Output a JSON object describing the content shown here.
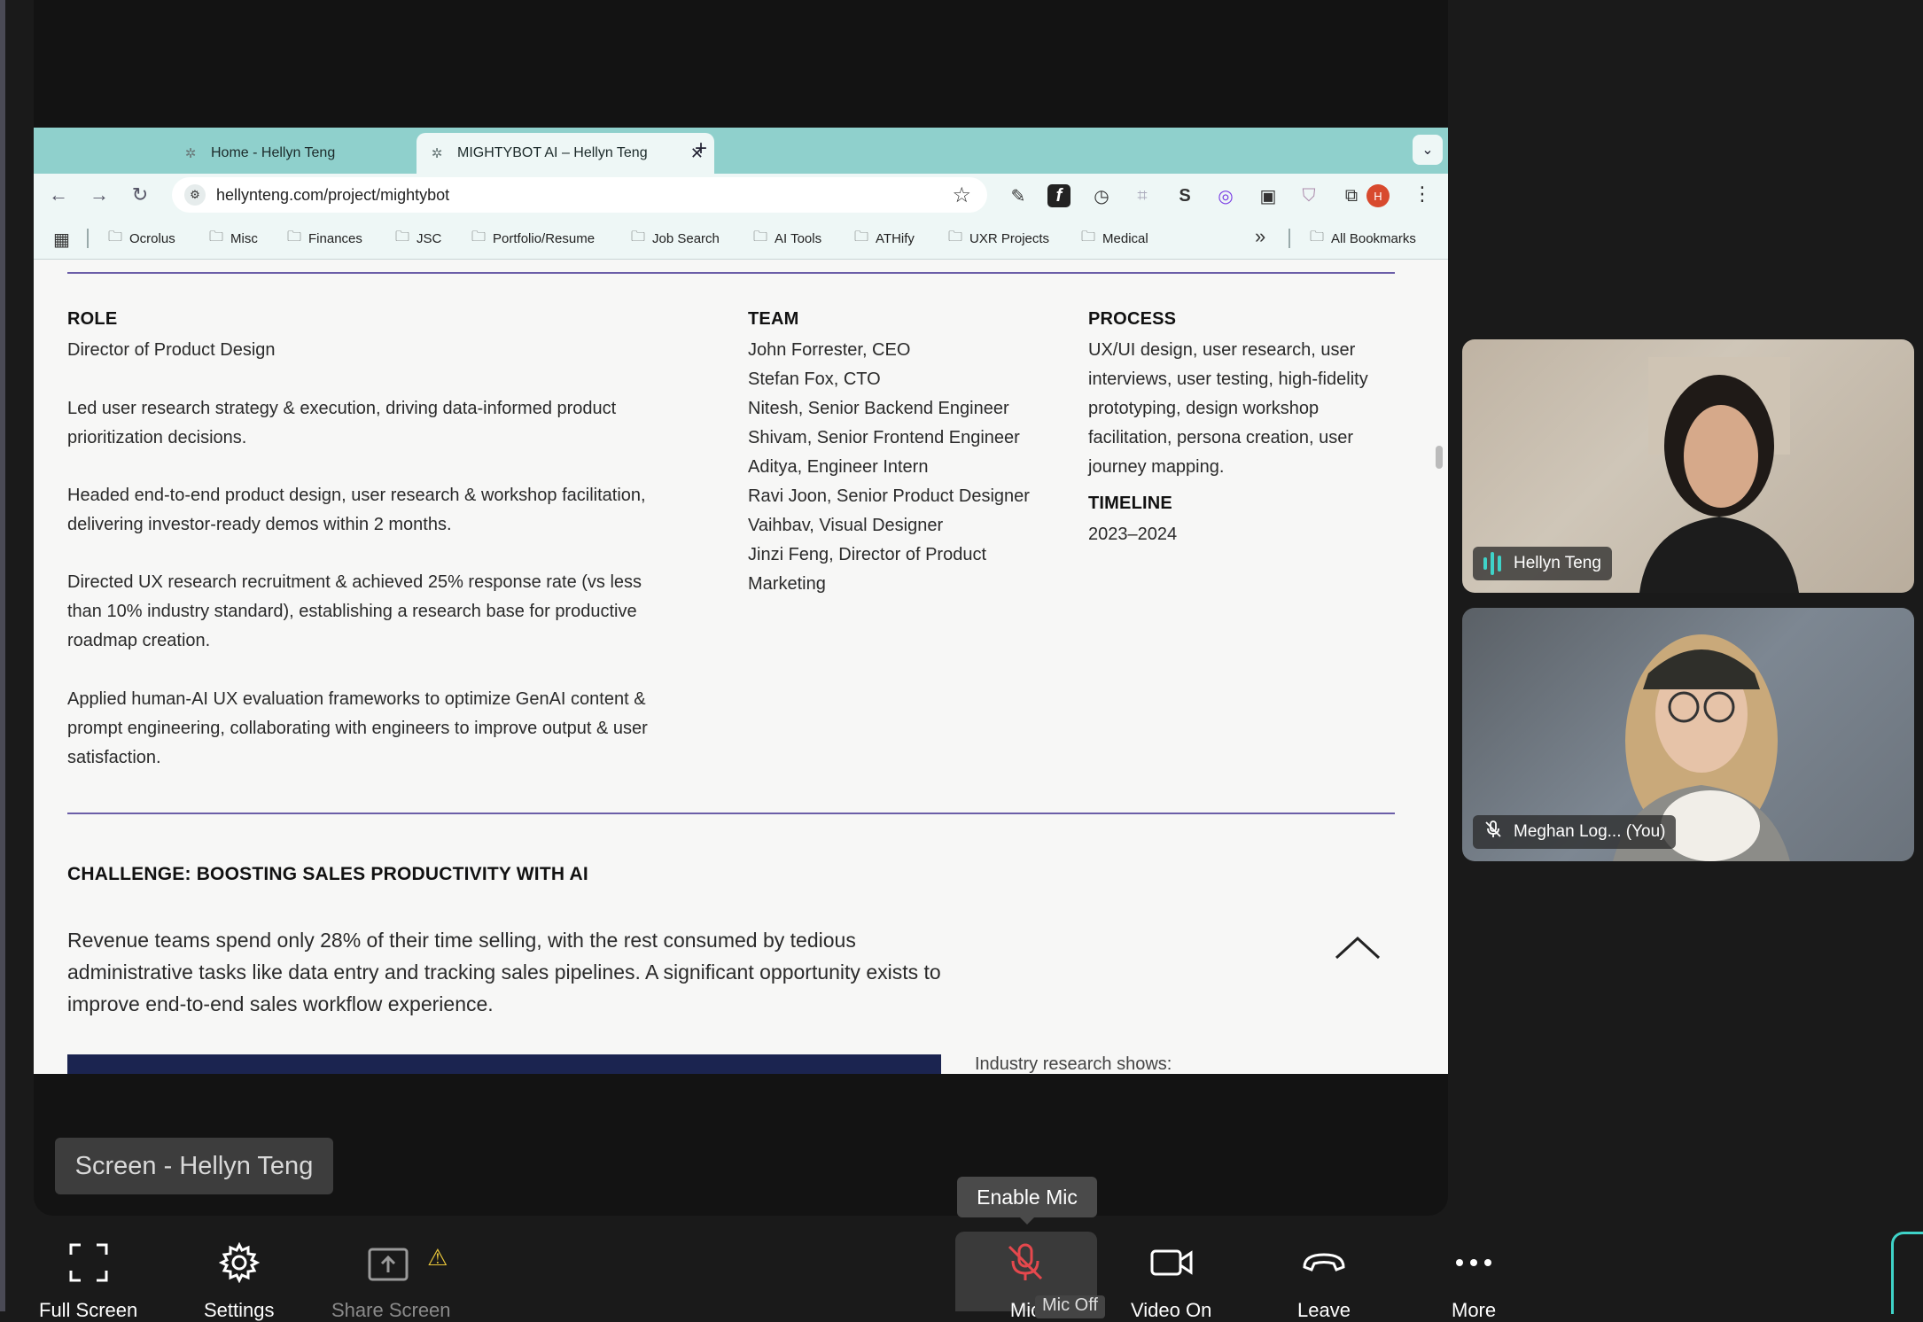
{
  "browser": {
    "tabs": [
      {
        "title": "Home - Hellyn Teng"
      },
      {
        "title": "MIGHTYBOT AI – Hellyn Teng"
      }
    ],
    "url": "hellynteng.com/project/mightybot",
    "profile_initial": "H",
    "bookmarks": [
      "Ocrolus",
      "Misc",
      "Finances",
      "JSC",
      "Portfolio/Resume",
      "Job Search",
      "AI Tools",
      "ATHify",
      "UXR Projects",
      "Medical"
    ],
    "all_bookmarks": "All Bookmarks"
  },
  "page": {
    "role": {
      "label": "ROLE",
      "title": "Director of Product Design",
      "paragraphs": [
        "Led user research strategy & execution, driving data-informed product prioritization decisions.",
        "Headed end-to-end product design, user research & workshop facilitation, delivering investor-ready demos within 2 months.",
        "Directed UX research recruitment & achieved 25% response rate (vs less than 10% industry standard), establishing a research base for productive roadmap creation.",
        "Applied human-AI UX evaluation frameworks to optimize GenAI content & prompt engineering, collaborating with engineers to improve output & user satisfaction."
      ]
    },
    "team": {
      "label": "TEAM",
      "members": [
        "John Forrester, CEO",
        "Stefan Fox, CTO",
        "Nitesh, Senior Backend Engineer",
        "Shivam, Senior Frontend Engineer",
        "Aditya, Engineer Intern",
        "Ravi Joon, Senior Product Designer",
        "Vaihbav, Visual Designer",
        "Jinzi Feng, Director of Product Marketing"
      ]
    },
    "process": {
      "label": "PROCESS",
      "text": "UX/UI design, user research, user interviews, user testing, high-fidelity prototyping, design workshop facilitation, persona creation, user journey mapping."
    },
    "timeline": {
      "label": "TIMELINE",
      "value": "2023–2024"
    },
    "challenge": {
      "heading": "CHALLENGE: BOOSTING SALES PRODUCTIVITY WITH AI",
      "text": "Revenue teams spend only 28% of their time selling, with the rest consumed by tedious administrative tasks like data entry and tracking sales pipelines. A significant opportunity exists to improve end-to-end sales workflow experience."
    },
    "cut_text": "Industry research shows:"
  },
  "meeting": {
    "participants": [
      {
        "name": "Hellyn Teng"
      },
      {
        "name": "Meghan Log... (You)"
      }
    ],
    "screen_label": "Screen - Hellyn Teng",
    "tooltip": "Enable Mic",
    "mic_off_tip": "Mic Off",
    "controls": {
      "full_screen": "Full Screen",
      "settings": "Settings",
      "share_screen": "Share Screen",
      "mic": "Mic",
      "video": "Video On",
      "leave": "Leave",
      "more": "More"
    }
  }
}
